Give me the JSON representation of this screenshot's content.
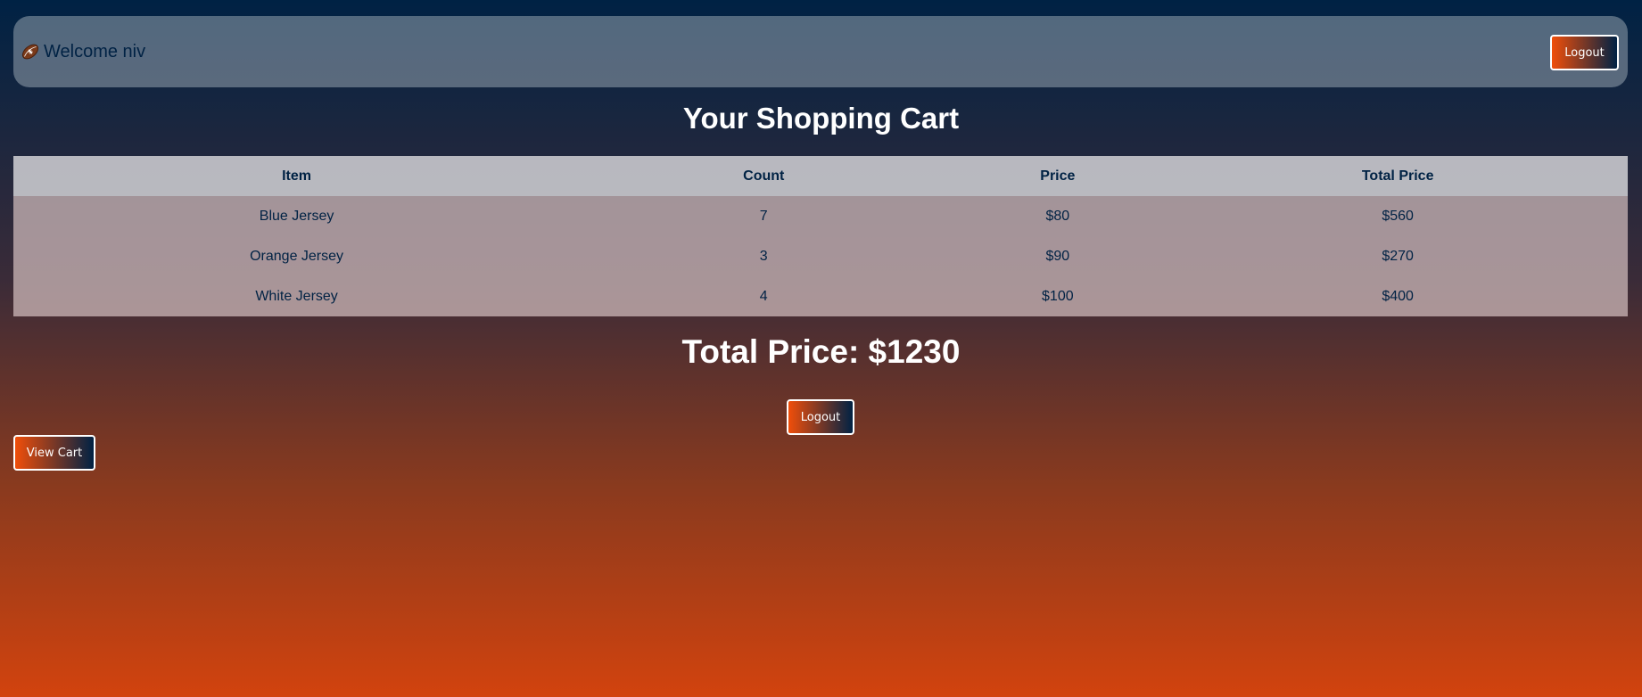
{
  "header": {
    "welcome_text": "Welcome niv",
    "icon": "american-football-icon",
    "logout_label": "Logout"
  },
  "page_title": "Your Shopping Cart",
  "table": {
    "columns": [
      "Item",
      "Count",
      "Price",
      "Total Price"
    ],
    "rows": [
      [
        "Blue Jersey",
        "7",
        "$80",
        "$560"
      ],
      [
        "Orange Jersey",
        "3",
        "$90",
        "$270"
      ],
      [
        "White Jersey",
        "4",
        "$100",
        "$400"
      ]
    ]
  },
  "total_price_text": "Total Price: $1230",
  "actions": {
    "logout_label": "Logout",
    "view_cart_label": "View Cart"
  },
  "colors": {
    "navy": "#002244",
    "orange": "#f04e0a",
    "white": "#ffffff"
  }
}
